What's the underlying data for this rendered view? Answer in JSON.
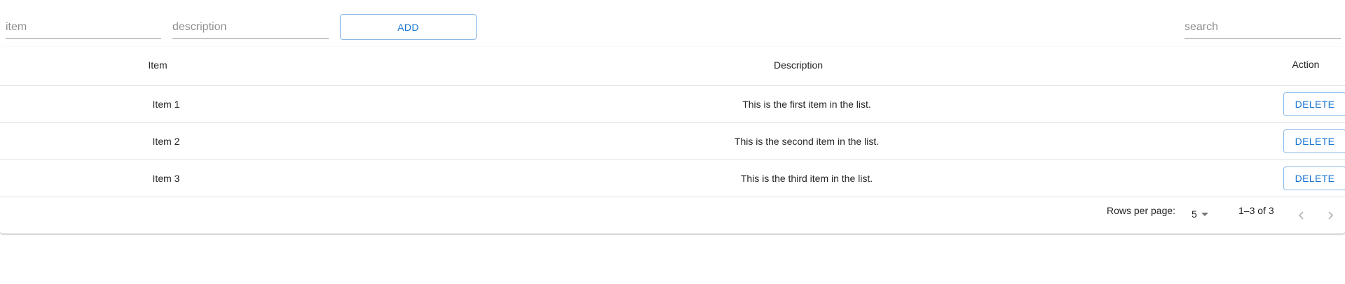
{
  "form": {
    "item_placeholder": "item",
    "description_placeholder": "description",
    "add_label": "ADD",
    "search_placeholder": "search"
  },
  "table": {
    "headers": [
      "Item",
      "Description",
      "Action"
    ],
    "rows": [
      {
        "item": "Item 1",
        "description": "This is the first item in the list.",
        "action": "DELETE"
      },
      {
        "item": "Item 2",
        "description": "This is the second item in the list.",
        "action": "DELETE"
      },
      {
        "item": "Item 3",
        "description": "This is the third item in the list.",
        "action": "DELETE"
      }
    ]
  },
  "pagination": {
    "rows_per_page_label": "Rows per page:",
    "rows_per_page_value": "5",
    "range_label": "1–3 of 3",
    "prev_icon": "chevron-left-icon",
    "next_icon": "chevron-right-icon"
  },
  "colors": {
    "primary": "#1976d2",
    "divider": "#e0e0e0"
  }
}
